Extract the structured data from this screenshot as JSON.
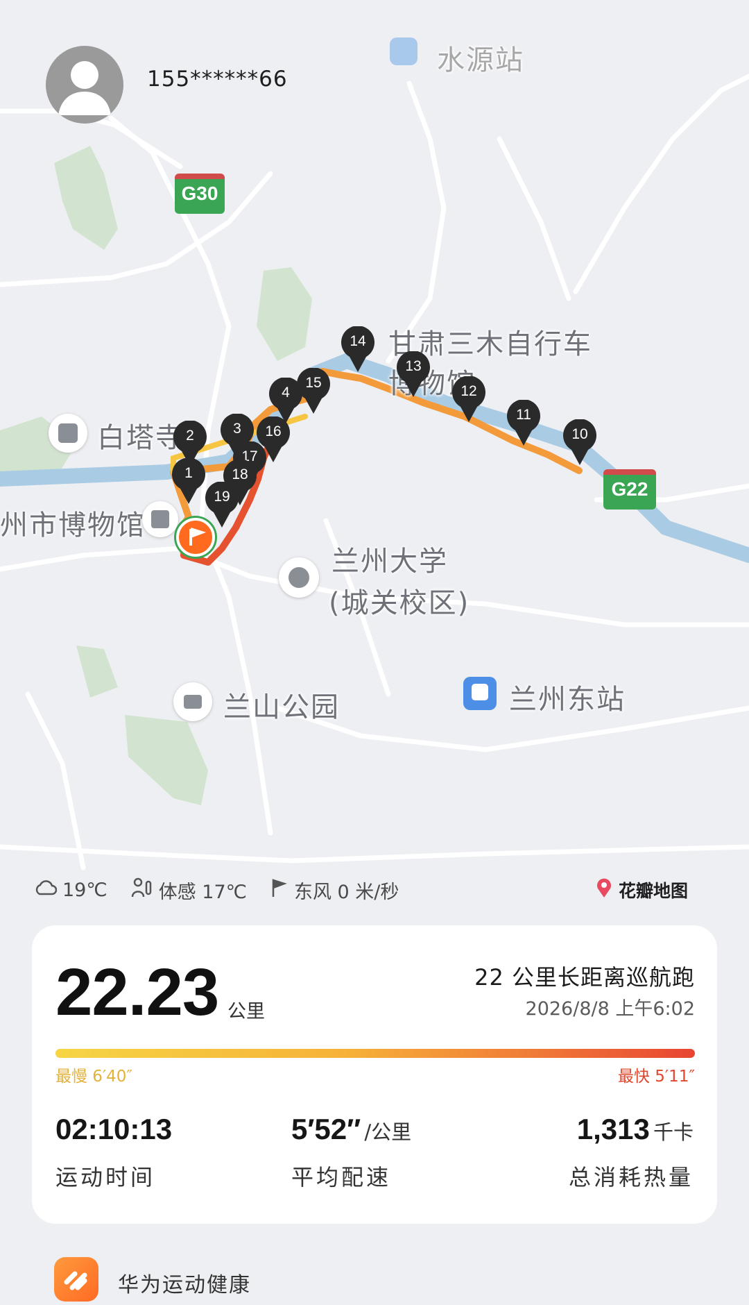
{
  "user": {
    "masked_phone": "155******66"
  },
  "map": {
    "labels": {
      "shuiyuan_station": "水源站",
      "road_g30": "G30",
      "road_g22": "G22",
      "bike_museum_line1": "甘肃三木自行车",
      "bike_museum_line2": "博物馆",
      "baita": "白塔寺",
      "museum": "州市博物馆",
      "lzu_line1": "兰州大学",
      "lzu_line2": "(城关校区)",
      "lanshan_park": "兰山公园",
      "lanzhou_east": "兰州东站"
    },
    "km_markers": [
      "1",
      "2",
      "3",
      "4",
      "10",
      "11",
      "12",
      "13",
      "14",
      "15",
      "16",
      "17",
      "18",
      "19"
    ]
  },
  "weather": {
    "temperature": "19℃",
    "feels_like": "体感 17℃",
    "wind": "东风 0 米/秒",
    "map_provider": "花瓣地图"
  },
  "workout": {
    "distance": "22.23",
    "distance_unit": "公里",
    "title": "22 公里长距离巡航跑",
    "datetime": "2026/8/8 上午6:02",
    "slowest": "最慢 6′40″",
    "fastest": "最快 5′11″",
    "duration": "02:10:13",
    "duration_label": "运动时间",
    "avg_pace": "5′52″",
    "avg_pace_unit": "/公里",
    "avg_pace_label": "平均配速",
    "calories": "1,313",
    "calories_unit": "千卡",
    "calories_label": "总消耗热量"
  },
  "footer": {
    "app_name": "华为运动健康"
  },
  "colors": {
    "route_orange": "#f39a3a",
    "route_red": "#e4522f",
    "river": "#9ec6e3",
    "park": "#c9e0c6",
    "card_bg": "#ffffff"
  }
}
